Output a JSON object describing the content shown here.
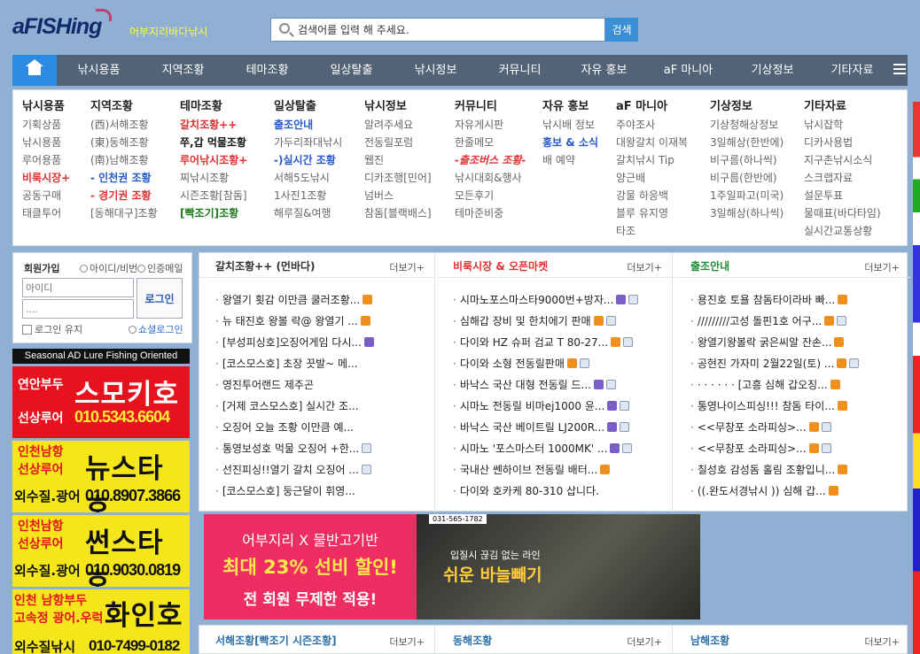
{
  "header": {
    "logo": "aFISHing",
    "slogan": "어부지리바다낚시",
    "search_placeholder": "검색어를 입력 해 주세요.",
    "search_button": "검색"
  },
  "nav": {
    "home_icon": "home-icon",
    "items": [
      "낚시용품",
      "지역조황",
      "테마조황",
      "일상탈출",
      "낚시정보",
      "커뮤니티",
      "자유 홍보",
      "aF 마니아",
      "기상정보",
      "기타자료"
    ],
    "menu_icon": "hamburger-icon"
  },
  "megamenu": {
    "columns": [
      {
        "title": "낚시용품",
        "items": [
          "기획상품",
          "낚시용품",
          "루어용품",
          "비룩시장+",
          "공동구매",
          "태클투어"
        ]
      },
      {
        "title": "지역조황",
        "items": [
          "(西)서해조황",
          "(東)동해조황",
          "(南)남해조황",
          "- 인천권 조황",
          "- 경기권 조황",
          "[동해대구]조황"
        ]
      },
      {
        "title": "테마조황",
        "items": [
          "갈치조황++",
          "쭈,갑 먹물조황",
          "루어낚시조황+",
          "찌낚시조황",
          "시즌조황[참돔]",
          "[빡조기]조황"
        ]
      },
      {
        "title": "일상탈출",
        "items": [
          "출조안내",
          "가두리좌대낚시",
          "-)실시간 조황",
          "서해5도낚시",
          "1사진1조황",
          "해루질&여행"
        ]
      },
      {
        "title": "낚시정보",
        "items": [
          "알려주세요",
          "전동릴포럼",
          "웹진",
          "디카조행[민어]",
          "넘버스",
          "참돔[블랙배스]"
        ]
      },
      {
        "title": "커뮤니티",
        "items": [
          "자유게시판",
          "한줄메모",
          "-출조버스 조황-",
          "낚시대회&행사",
          "모든후기",
          "테마준비중"
        ]
      },
      {
        "title": "자유 홍보",
        "items": [
          "낚시배 정보",
          "홍보 & 소식",
          "배 예약"
        ]
      },
      {
        "title": "aF 마니아",
        "items": [
          "주야조사",
          "대왕갈치 이재복",
          "갈치낚시 Tip",
          "양근배",
          "강물 하응백",
          "블루 유지영",
          "타조"
        ]
      },
      {
        "title": "기상정보",
        "items": [
          "기상청해상정보",
          "3일해상(한반에)",
          "비구름(하나씩)",
          "비구름(한반에)",
          "1주일파고(미국)",
          "3일해상(하나씩)"
        ]
      },
      {
        "title": "기타자료",
        "items": [
          "낚시잡학",
          "디카사용법",
          "지구촌낚시소식",
          "스크랩자료",
          "설문투표",
          "물때표(바다타임)",
          "실시간교통상황"
        ]
      }
    ]
  },
  "login": {
    "join": "회원가입",
    "find": "아이디/비번",
    "cert": "인증메일",
    "id_placeholder": "아이디",
    "pw_placeholder": "....",
    "login_button": "로그인",
    "keep": "로그인 유지",
    "social": "쇼셜로그인"
  },
  "ads": {
    "title": "Seasonal AD Lure Fishing Oriented",
    "ad1": {
      "line1": "연안부두",
      "line2": "선상루어",
      "name": "스모키호",
      "phone": "010.5343.6604"
    },
    "ad2": {
      "line1": "인천남항",
      "line2": "선상루어",
      "name": "뉴스타호",
      "line3": "외수질.광어",
      "phone": "010.8907.3866"
    },
    "ad3": {
      "line1": "인천남항",
      "line2": "선상루어",
      "name": "썬스타호",
      "line3": "외수질.광어",
      "phone": "010.9030.0819"
    },
    "ad4": {
      "line1": "인천 남항부두",
      "line2": "고속정 광어.우럭",
      "name": "화인호",
      "line3": "외수질낚시",
      "phone": "010-7499-0182"
    }
  },
  "boards": [
    {
      "title": "갈치조황++ (먼바다)",
      "title_color": "#333333",
      "more": "더보기+",
      "items": [
        {
          "text": "왕열기 횟감 이만큼 쿨러조황...",
          "icons": [
            "n"
          ]
        },
        {
          "text": "뉴 태진호 왕볼 락@ 왕열기 ...",
          "icons": [
            "n"
          ]
        },
        {
          "text": "[부성피싱호]오징어게임 다시...",
          "icons": [
            "u"
          ]
        },
        {
          "text": "[코스모스호] 초장 끗발~ 메...",
          "icons": []
        },
        {
          "text": "영진투어랜드 제주곤",
          "icons": []
        },
        {
          "text": "[거제 코스모스호] 실시간 조...",
          "icons": []
        },
        {
          "text": "오징어 오늘 조황 이만큼 예...",
          "icons": []
        },
        {
          "text": "통영보성호 먹물 오징어 +한...",
          "icons": [
            "f"
          ]
        },
        {
          "text": "선진피싱!!열기 갈치 오징어 ...",
          "icons": [
            "f"
          ]
        },
        {
          "text": "[코스모스호] 둥근달이 휘영...",
          "icons": []
        }
      ]
    },
    {
      "title": "비룩시장 & 오픈마켓",
      "title_color": "#e03232",
      "more": "더보기+",
      "items": [
        {
          "text": "시마노포스마스타9000번+방자...",
          "icons": [
            "u",
            "f"
          ]
        },
        {
          "text": "심해갑 장비 및 한치에기 판매",
          "icons": [
            "n",
            "f"
          ]
        },
        {
          "text": "다이와 HZ 슈퍼 검교 T 80-27...",
          "icons": [
            "n",
            "f"
          ]
        },
        {
          "text": "다이와 소형 전동릴판매",
          "icons": [
            "n",
            "f"
          ]
        },
        {
          "text": "바낙스 국산 대형 전동릴 드...",
          "icons": [
            "u",
            "f"
          ]
        },
        {
          "text": "시마노 전동릴 비마ej1000 윤...",
          "icons": [
            "u",
            "f"
          ]
        },
        {
          "text": "바낙스 국산 베이트릴 LJ200R...",
          "icons": [
            "u",
            "f"
          ]
        },
        {
          "text": "시마노 '포스마스터 1000MK' ...",
          "icons": [
            "u",
            "f"
          ]
        },
        {
          "text": "국내산 쎈하이브 전동릴 배터...",
          "icons": [
            "n"
          ]
        },
        {
          "text": "다이와 호카케 80-310 삽니다.",
          "icons": []
        }
      ]
    },
    {
      "title": "출조안내",
      "title_color": "#1f8f3a",
      "more": "더보기+",
      "items": [
        {
          "text": "용진호 토욜 참돔타이라바 빠...",
          "icons": [
            "n"
          ]
        },
        {
          "text": "/////////고성 돌핀1호 어구...",
          "icons": [
            "n",
            "f"
          ]
        },
        {
          "text": "왕열기왕볼락 굵은씨알 잔손...",
          "icons": [
            "n"
          ]
        },
        {
          "text": "공현진 가자미 2월22일(토) ...",
          "icons": [
            "n",
            "f"
          ]
        },
        {
          "text": "· · · · · · [고흥 심해 갑오징...",
          "icons": [
            "n"
          ]
        },
        {
          "text": "통영나이스피싱!!! 참돔 타이...",
          "icons": [
            "n"
          ]
        },
        {
          "text": "<<무창포 소라피싱>...",
          "icons": [
            "n",
            "f"
          ]
        },
        {
          "text": "<<무창포 소라피싱>...",
          "icons": [
            "n",
            "f"
          ]
        },
        {
          "text": "칠성호 감성돔 홀림 조황입니...",
          "icons": [
            "n"
          ]
        },
        {
          "text": "((.완도서경낚시 )) 심해 갑...",
          "icons": [
            "n"
          ]
        }
      ]
    }
  ],
  "banner": {
    "line1": "어부지리 X 물반고기반",
    "line2": "최대 23% 선비 할인!",
    "line3": "전 회원 무제한 적용!",
    "phone": "031-565-1782",
    "line4": "입질시 끊김 없는 라인",
    "line5": "쉬운 바늘빼기"
  },
  "bottom_boards": [
    {
      "title": "서해조황[빡조기 시즌조황]",
      "more": "더보기+"
    },
    {
      "title": "동해조황",
      "more": "더보기+"
    },
    {
      "title": "남해조황",
      "more": "더보기+"
    }
  ]
}
